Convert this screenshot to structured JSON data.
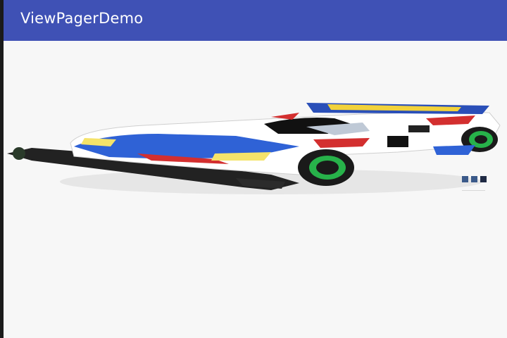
{
  "app_bar": {
    "title": "ViewPagerDemo",
    "color": "#3f51b5"
  },
  "pager": {
    "current_page_image": "mini-4wd-race-car",
    "page_count": 3,
    "current_index": 2
  }
}
